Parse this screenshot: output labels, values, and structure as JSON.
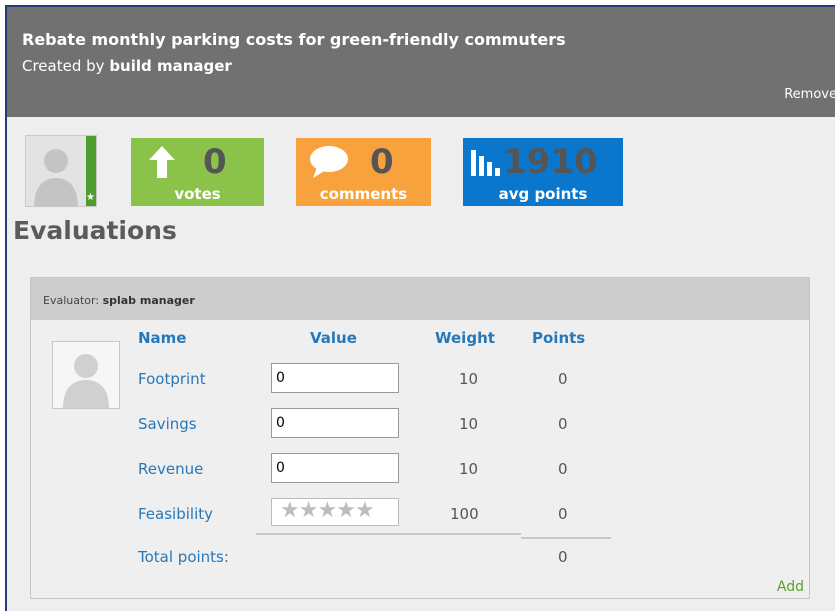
{
  "header": {
    "title": "Rebate monthly parking costs for green-friendly commuters",
    "created_by_prefix": "Created by",
    "creator": "build manager",
    "remove_label": "Remove"
  },
  "stats": {
    "votes": {
      "value": "0",
      "label": "votes",
      "color": "#8bc34a"
    },
    "comments": {
      "value": "0",
      "label": "comments",
      "color": "#f7a23d"
    },
    "avg_points": {
      "value": "1910",
      "label": "avg points",
      "color": "#0a77cc"
    }
  },
  "evaluations": {
    "title": "Evaluations",
    "evaluator_prefix": "Evaluator:",
    "evaluator": "splab manager",
    "columns": {
      "name": "Name",
      "value": "Value",
      "weight": "Weight",
      "points": "Points"
    },
    "rows": [
      {
        "name": "Footprint",
        "value": "0",
        "weight": "10",
        "points": "0"
      },
      {
        "name": "Savings",
        "value": "0",
        "weight": "10",
        "points": "0"
      },
      {
        "name": "Revenue",
        "value": "0",
        "weight": "10",
        "points": "0"
      },
      {
        "name": "Feasibility",
        "rating": 0,
        "rating_max": 5,
        "weight": "100",
        "points": "0"
      }
    ],
    "total_label": "Total points:",
    "total_points": "0",
    "add_label": "Add"
  }
}
